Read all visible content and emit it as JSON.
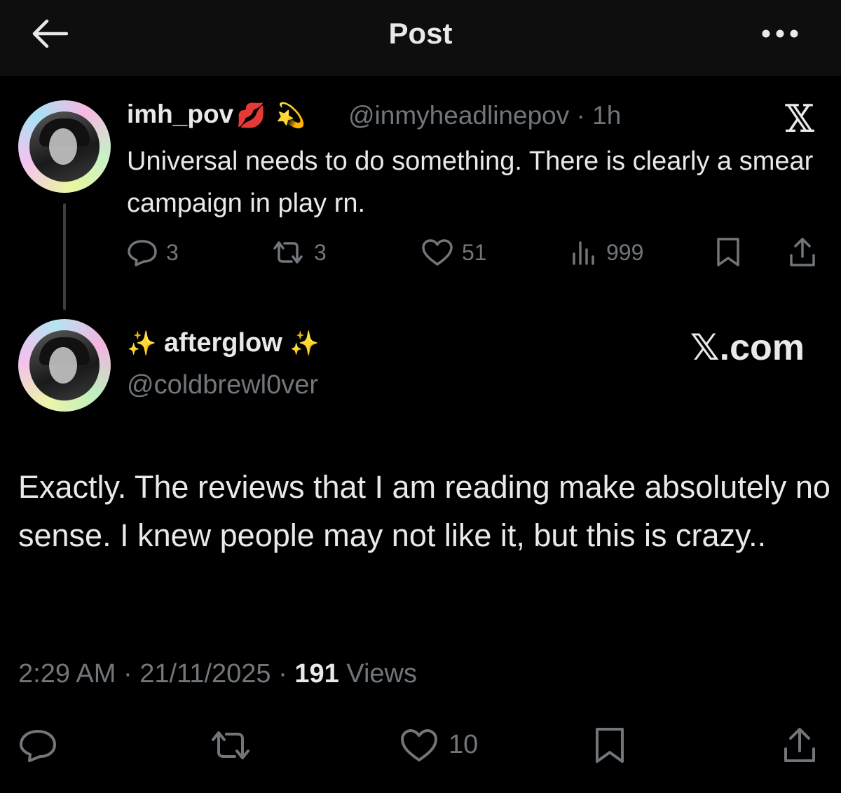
{
  "header": {
    "title": "Post",
    "back_icon": "arrow-left-icon",
    "more_icon": "more-horizontal-icon"
  },
  "quoted_post": {
    "display_name": "imh_pov",
    "name_emojis": [
      "💋",
      "💫"
    ],
    "handle": "@inmyheadlinepov",
    "time": "· 1h",
    "source_logo": "𝕏",
    "text": "Universal needs to do something. There is clearly a smear campaign in play rn.",
    "actions": {
      "replies": "3",
      "reposts": "3",
      "likes": "51",
      "views": "999"
    }
  },
  "reply_post": {
    "display_name": "afterglow",
    "name_prefix": "✨",
    "name_suffix": "✨",
    "handle": "@coldbrewl0ver",
    "site_label": "𝕏.com",
    "text": "Exactly. The reviews that I am reading make absolutely no sense. I knew people may not like it, but this is crazy..",
    "timestamp": "2:29 AM · 21/11/2025 · ",
    "views_count": "191",
    "views_label": " Views",
    "actions": {
      "likes": "10"
    }
  },
  "colors": {
    "background": "#000000",
    "text": "#e7e9ea",
    "muted": "#71767b",
    "header": "#0e0e0e"
  }
}
